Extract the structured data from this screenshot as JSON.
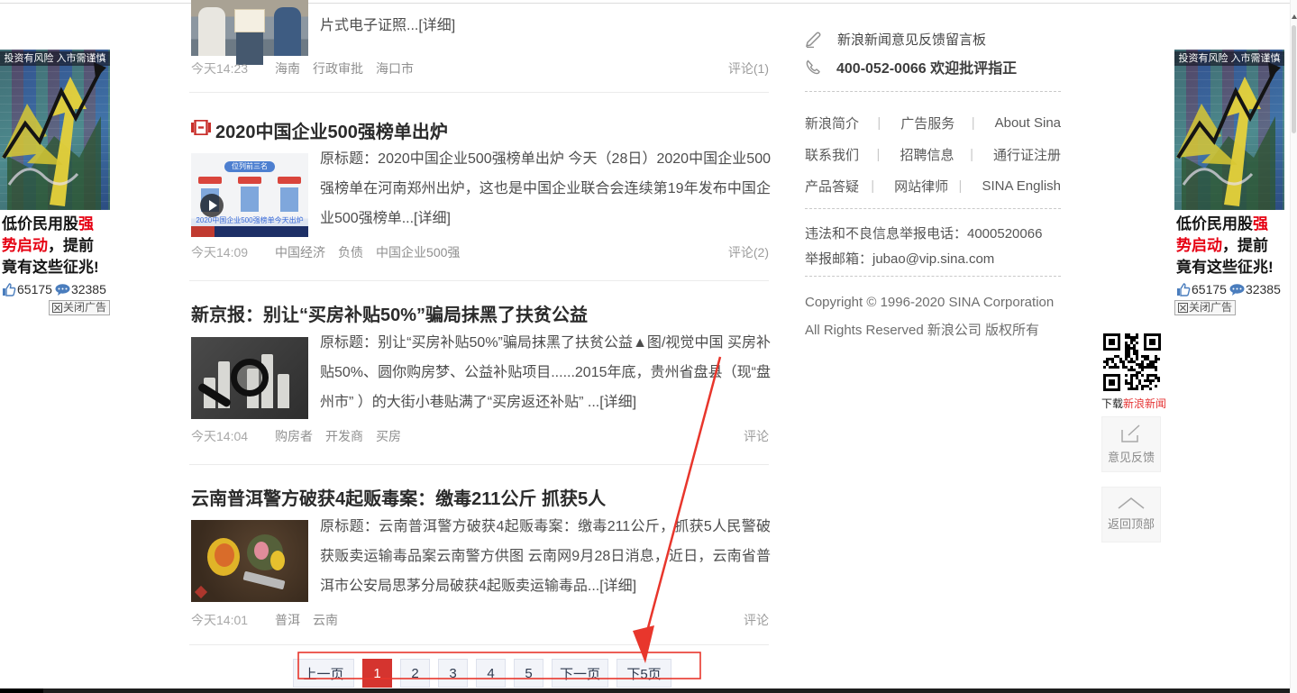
{
  "feed": {
    "partial": {
      "snippet": "片式电子证照...[详细]",
      "time": "今天14:23",
      "tags": [
        "海南",
        "行政审批",
        "海口市"
      ],
      "comments": "评论(1)"
    },
    "articles": [
      {
        "title": "2020中国企业500强榜单出炉",
        "summary": "原标题：2020中国企业500强榜单出炉 今天（28日）2020中国企业500强榜单在河南郑州出炉，这也是中国企业联合会连续第19年发布中国企业500强榜单...[详细]",
        "time": "今天14:09",
        "tags": [
          "中国经济",
          "负债",
          "中国企业500强"
        ],
        "comments": "评论(2)",
        "video_badge": "位列前三名",
        "video_caption": "2020中国企业500强榜单今天出炉"
      },
      {
        "title": "新京报：别让“买房补贴50%”骗局抹黑了扶贫公益",
        "summary": "原标题：别让“买房补贴50%”骗局抹黑了扶贫公益▲图/视觉中国 买房补贴50%、圆你购房梦、公益补贴项目......2015年底，贵州省盘县（现“盘州市” ）的大街小巷贴满了“买房返还补贴” ...[详细]",
        "time": "今天14:04",
        "tags": [
          "购房者",
          "开发商",
          "买房"
        ],
        "comments": "评论"
      },
      {
        "title": "云南普洱警方破获4起贩毒案：缴毒211公斤 抓获5人",
        "summary": "原标题：云南普洱警方破获4起贩毒案：缴毒211公斤，抓获5人民警破获贩卖运输毒品案云南警方供图 云南网9月28日消息，近日，云南省普洱市公安局思茅分局破获4起贩卖运输毒品...[详细]",
        "time": "今天14:01",
        "tags": [
          "普洱",
          "云南"
        ],
        "comments": "评论"
      }
    ],
    "pagination": {
      "prev": "上一页",
      "pages": [
        "1",
        "2",
        "3",
        "4",
        "5"
      ],
      "active_page": "1",
      "next": "下一页",
      "next5": "下5页"
    }
  },
  "footer": {
    "feedback_board": "新浪新闻意见反馈留言板",
    "hotline": "400-052-0066 欢迎批评指正",
    "links": [
      "新浪简介",
      "广告服务",
      "About Sina",
      "联系我们",
      "招聘信息",
      "通行证注册",
      "产品答疑",
      "网站律师",
      "SINA English"
    ],
    "separator": "|",
    "report_phone": "违法和不良信息举报电话：4000520066",
    "report_email": "举报邮箱：jubao@vip.sina.com",
    "copyright": "Copyright © 1996-2020 SINA Corporation",
    "rights": "All Rights Reserved 新浪公司 版权所有"
  },
  "side_widgets": {
    "qr_caption_prefix": "下载",
    "qr_caption_highlight": "新浪新闻",
    "feedback_button": "意见反馈",
    "back_to_top": "返回顶部"
  },
  "ad": {
    "disclaimer": "投资有风险 入市需谨慎",
    "text_pre": "低价民用股",
    "text_red": "强势启动",
    "text_post": "，提前竟有这些征兆!",
    "likes": "65175",
    "comments": "32385",
    "close_label": "关闭广告"
  },
  "colors": {
    "active_page_red": "#d5342f",
    "annotation_red": "#e8362c",
    "ad_highlight_red": "#e60012",
    "qr_caption_red": "#e53333"
  }
}
